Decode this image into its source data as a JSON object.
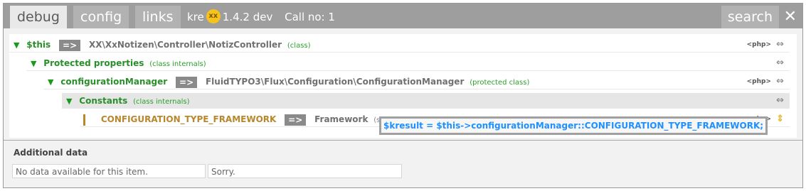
{
  "tabs": {
    "debug": "debug",
    "config": "config",
    "links": "links"
  },
  "header_info": {
    "app_prefix": "kre",
    "logo_text": "xx",
    "version": "1.4.2 dev",
    "call_label": "Call no: 1"
  },
  "search_label": "search",
  "close_glyph": "✕",
  "tree": {
    "this_key": "$this",
    "op": "=>",
    "this_class": "XX\\XxNotizen\\Controller\\NotizController",
    "this_type": "(class)",
    "protected_label": "Protected properties",
    "protected_type": "(class internals)",
    "config_key": "configurationManager",
    "config_class": "FluidTYPO3\\Flux\\Configuration\\ConfigurationManager",
    "config_type": "(protected class)",
    "constants_label": "Constants",
    "constants_type": "(class internals)",
    "const_key": "CONFIGURATION_TYPE_FRAMEWORK",
    "const_value": "Framework",
    "const_type": "(string 9)",
    "php_badge": "<php>",
    "expand_glyph": "⇔",
    "collapse_glyph": "⇕",
    "tooltip": "$kresult = $this->configurationManager::CONFIGURATION_TYPE_FRAMEWORK;"
  },
  "additional": {
    "title": "Additional data",
    "cell_1": "No data available for this item.",
    "cell_2": "Sorry."
  },
  "colors": {
    "header_bg": "#9e9e9e",
    "key_green": "#2a8f2a",
    "const_gold": "#b8862d",
    "tooltip_blue": "#1e90ff"
  }
}
